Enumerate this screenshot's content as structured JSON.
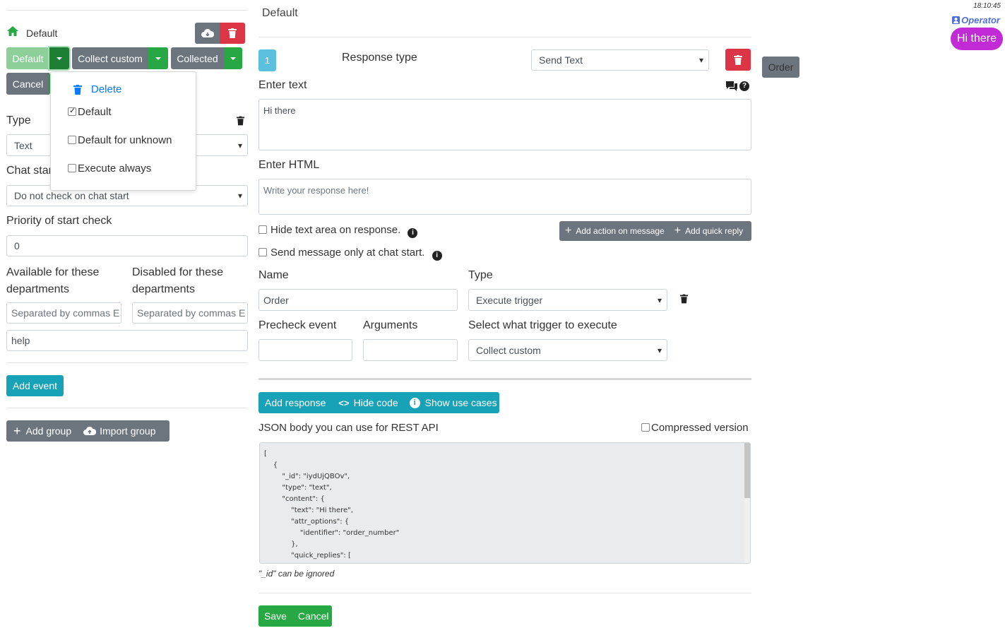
{
  "left": {
    "breadcrumb": "Default",
    "group_buttons": {
      "default": "Default",
      "collect_custom": "Collect custom",
      "collected": "Collected",
      "cancel": "Cancel"
    },
    "dropdown": {
      "delete": "Delete",
      "default": "Default",
      "default_unknown": "Default for unknown",
      "execute_always": "Execute always"
    },
    "type_label": "Type",
    "type_value": "Text",
    "chat_start_label": "Chat star",
    "chat_start_value": "Do not check on chat start",
    "priority_label": "Priority of start check",
    "priority_value": "0",
    "available_label": "Available for these departments",
    "disabled_label": "Disabled for these departments",
    "available_placeholder": "Separated by commas E",
    "disabled_placeholder": "Separated by commas E",
    "event_value": "help",
    "add_event": "Add event",
    "add_group": "Add group",
    "import_group": "Import group"
  },
  "main": {
    "title": "Default",
    "response_number": "1",
    "response_type_label": "Response type",
    "response_type_value": "Send Text",
    "order_button": "Order",
    "enter_text_label": "Enter text",
    "text_value": "Hi there",
    "enter_html_label": "Enter HTML",
    "html_placeholder": "Write your response here!",
    "hide_text_area": "Hide text area on response.",
    "send_only_start": "Send message only at chat start.",
    "add_action": "Add action on message",
    "add_quick_reply": "Add quick reply",
    "name_label": "Name",
    "name_value": "Order",
    "type_label": "Type",
    "type_value": "Execute trigger",
    "precheck_label": "Precheck event",
    "arguments_label": "Arguments",
    "select_trigger_label": "Select what trigger to execute",
    "trigger_value": "Collect custom",
    "add_response": "Add response",
    "hide_code": "Hide code",
    "show_use_cases": "Show use cases",
    "json_label": "JSON body you can use for REST API",
    "compressed_label": "Compressed version",
    "json_lines": [
      "[",
      "    {",
      "        \"_id\": \"iydUjQBOv\",",
      "        \"type\": \"text\",",
      "        \"content\": {",
      "            \"text\": \"Hi there\",",
      "            \"attr_options\": {",
      "                \"identifier\": \"order_number\"",
      "            },",
      "            \"quick_replies\": [",
      "                {"
    ],
    "id_note": "\"_id\" can be ignored",
    "save": "Save",
    "cancel": "Cancel"
  },
  "preview": {
    "time": "18:10:45",
    "operator": "Operator",
    "bubble": "Hi there"
  },
  "colors": {
    "primary": "#007bff",
    "bubble": "#c02bd6",
    "operator": "#4f6fd8"
  }
}
